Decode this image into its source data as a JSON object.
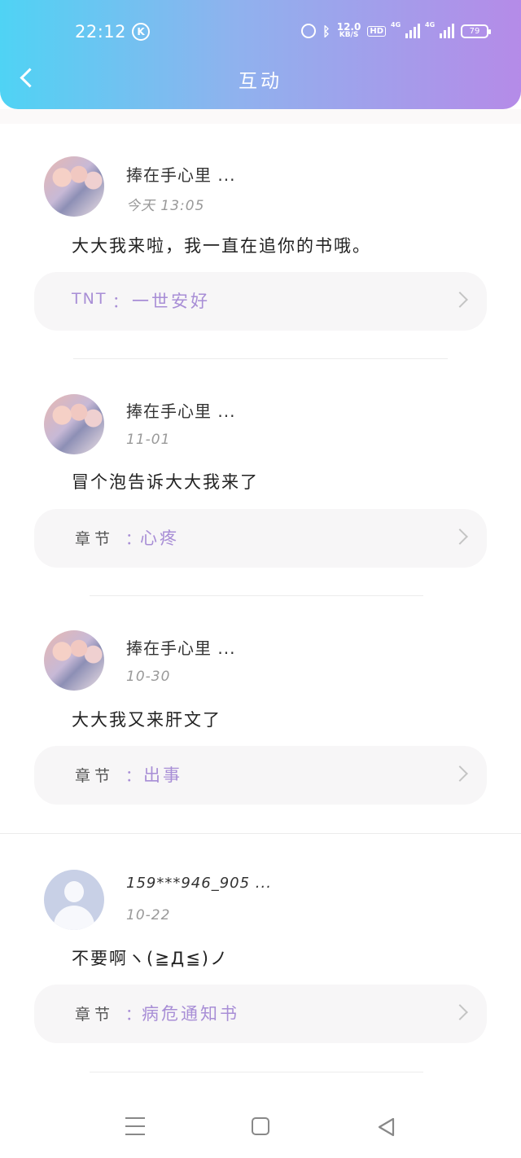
{
  "status_bar": {
    "time": "22:12",
    "k_badge": "K",
    "net_speed_value": "12.0",
    "net_speed_unit": "KB/S",
    "hd_label": "HD",
    "signal_1": "4G",
    "signal_2": "4G",
    "battery": "79"
  },
  "header": {
    "title": "互动"
  },
  "comments": [
    {
      "username": "捧在手心里 ...",
      "time": "今天 13:05",
      "text": "大大我来啦，我一直在追你的书哦。",
      "ref_label": "TNT",
      "ref_sep": "：",
      "ref_value": "一世安好"
    },
    {
      "username": "捧在手心里 ...",
      "time": "11-01",
      "text": "冒个泡告诉大大我来了",
      "ref_label": "章节",
      "ref_sep": "：",
      "ref_value": "心疼"
    },
    {
      "username": "捧在手心里 ...",
      "time": "10-30",
      "text": "大大我又来肝文了",
      "ref_label": "章节",
      "ref_sep": "：",
      "ref_value": "出事"
    },
    {
      "username": "159***946_905 ...",
      "time": "10-22",
      "text": "不要啊ヽ(≧Д≦)ノ",
      "ref_label": "章节",
      "ref_sep": "：",
      "ref_value": "病危通知书"
    }
  ],
  "colors": {
    "header_gradient_start": "#4fd3f4",
    "header_gradient_end": "#b58be8",
    "accent_purple": "#a88ed6"
  },
  "icons": {
    "back": "chevron-left-icon",
    "ref_arrow": "chevron-right-icon",
    "nav_menu": "menu-icon",
    "nav_home": "home-square-icon",
    "nav_back": "triangle-back-icon"
  }
}
